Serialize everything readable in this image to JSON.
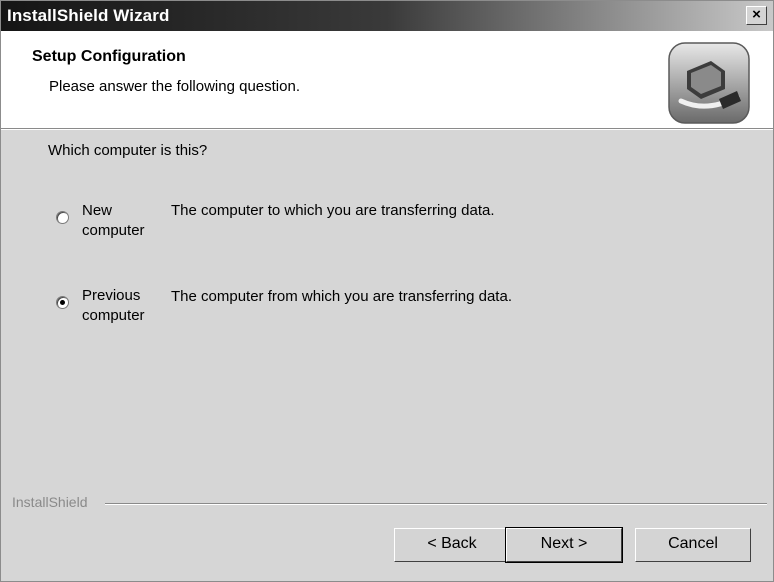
{
  "window": {
    "title": "InstallShield Wizard",
    "close_label": "×"
  },
  "header": {
    "title": "Setup Configuration",
    "subtitle": "Please answer the following question.",
    "icon": "computer-transfer-icon"
  },
  "content": {
    "question": "Which computer is this?",
    "options": [
      {
        "label_line1": "New",
        "label_line2": "computer",
        "description": "The computer to which you are transferring data.",
        "selected": false
      },
      {
        "label_line1": "Previous",
        "label_line2": "computer",
        "description": "The computer from which you are transferring data.",
        "selected": true
      }
    ]
  },
  "footer": {
    "group_label": "InstallShield",
    "back_label": "< Back",
    "next_label": "Next >",
    "cancel_label": "Cancel"
  }
}
